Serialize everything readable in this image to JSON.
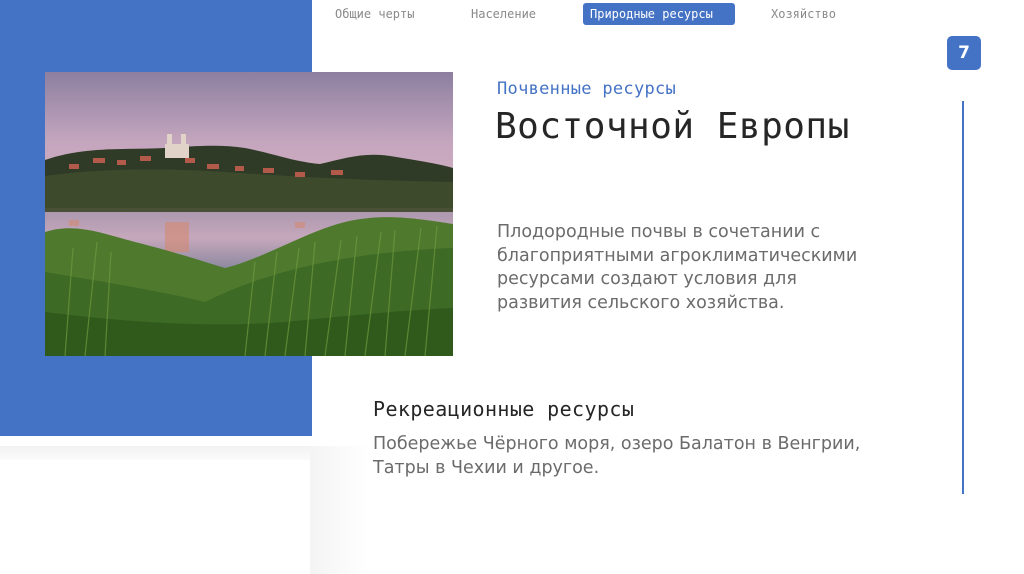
{
  "nav": {
    "tabs": [
      {
        "label": "Общие черты",
        "active": false
      },
      {
        "label": "Население",
        "active": false
      },
      {
        "label": "Природные ресурсы",
        "active": true
      },
      {
        "label": "Хозяйство",
        "active": false
      }
    ]
  },
  "slide": {
    "page_number": "7",
    "subtitle": "Почвенные ресурсы",
    "title": "Восточной Европы",
    "body": "Плодородные почвы в сочетании с благоприятными агроклиматическими ресурсами создают условия для развития сельского хозяйства.",
    "section2_title": "Рекреационные ресурсы",
    "section2_body": "Побережье Чёрного моря, озеро Балатон в Венгрии, Татры в Чехии и другое."
  },
  "colors": {
    "accent": "#4472c4",
    "heading": "#262626",
    "body_text": "#6b6b6b"
  },
  "image": {
    "subject": "lakeside-town-photo"
  }
}
